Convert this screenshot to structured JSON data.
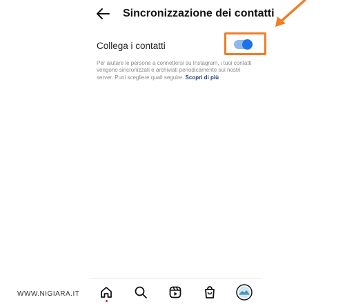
{
  "header": {
    "title": "Sincronizzazione dei contatti",
    "back_icon": "arrow-left-icon"
  },
  "setting": {
    "label": "Collega i contatti",
    "toggle_state": "on",
    "description": "Per aiutare le persone a connettersi su Instagram, i tuoi contatti vengono sincronizzati e archiviati periodicamente sui nostri server. Puoi scegliere quali seguire.",
    "link_text": "Scopri di più"
  },
  "annotation": {
    "highlight_color": "#f17d24",
    "icon": "arrow-pointer-icon"
  },
  "navbar": {
    "items": [
      "home-icon",
      "search-icon",
      "reels-icon",
      "shop-icon",
      "profile-avatar-icon"
    ]
  },
  "watermark": "WWW.NIGIARA.IT",
  "colors": {
    "accent": "#1a73e8",
    "toggle_track": "#8fb8f2",
    "link": "#1a3e73",
    "notification_dot": "#e02030"
  }
}
